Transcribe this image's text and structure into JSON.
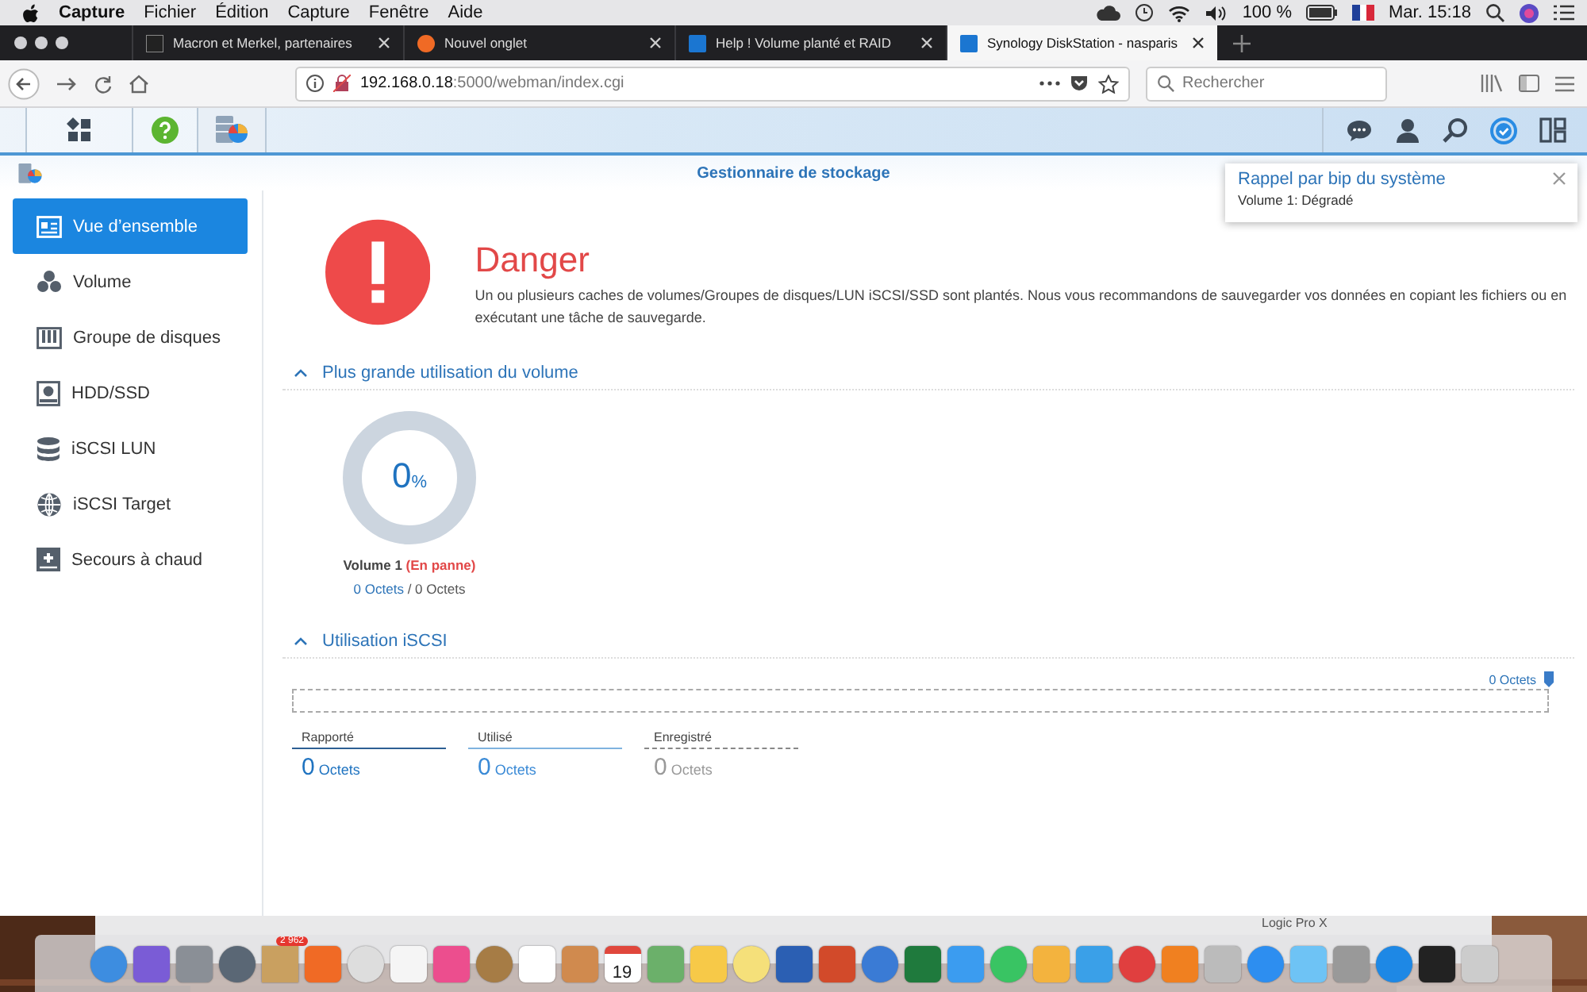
{
  "menubar": {
    "app": "Capture",
    "items": [
      "Fichier",
      "Édition",
      "Capture",
      "Fenêtre",
      "Aide"
    ],
    "battery": "100 %",
    "clock": "Mar. 15:18"
  },
  "browser": {
    "tabs": [
      {
        "title": "Macron et Merkel, partenaires",
        "selected": false
      },
      {
        "title": "Nouvel onglet",
        "selected": false
      },
      {
        "title": "Help ! Volume planté et RAID",
        "selected": false
      },
      {
        "title": "Synology DiskStation - nasparis",
        "selected": true
      }
    ],
    "url": {
      "host": "192.168.0.18",
      "rest": ":5000/webman/index.cgi"
    },
    "search": {
      "placeholder": "Rechercher"
    }
  },
  "window": {
    "title": "Gestionnaire de stockage"
  },
  "sidebar": {
    "items": [
      {
        "label": "Vue d’ensemble",
        "selected": true
      },
      {
        "label": "Volume",
        "selected": false
      },
      {
        "label": "Groupe de disques",
        "selected": false
      },
      {
        "label": "HDD/SSD",
        "selected": false
      },
      {
        "label": "iSCSI LUN",
        "selected": false
      },
      {
        "label": "iSCSI Target",
        "selected": false
      },
      {
        "label": "Secours à chaud",
        "selected": false
      }
    ]
  },
  "alert": {
    "title": "Danger",
    "message": "Un ou plusieurs caches de volumes/Groupes de disques/LUN iSCSI/SSD sont plantés. Nous vous recommandons de sauvegarder vos données en copiant les fichiers ou en exécutant une tâche de sauvegarde."
  },
  "volume_usage": {
    "title": "Plus grande utilisation du volume",
    "value": "0",
    "unit": "%",
    "level": 0,
    "name": "Volume 1",
    "status": "(En panne)",
    "used": "0 Octets",
    "separator": "/",
    "total": "0 Octets"
  },
  "iscsi_usage": {
    "title": "Utilisation iSCSI",
    "scale": "0 Octets",
    "stats": [
      {
        "kind": "reported",
        "label": "Rapporté",
        "value": "0",
        "unit": "Octets"
      },
      {
        "kind": "used",
        "label": "Utilisé",
        "value": "0",
        "unit": "Octets"
      },
      {
        "kind": "registered",
        "label": "Enregistré",
        "value": "0",
        "unit": "Octets"
      }
    ]
  },
  "notification": {
    "title": "Rappel par bip du système",
    "message": "Volume 1: Dégradé"
  },
  "desktop": {
    "window_text": "Logic Pro X",
    "dock_badge": "2 962",
    "calendar_day": "19"
  }
}
